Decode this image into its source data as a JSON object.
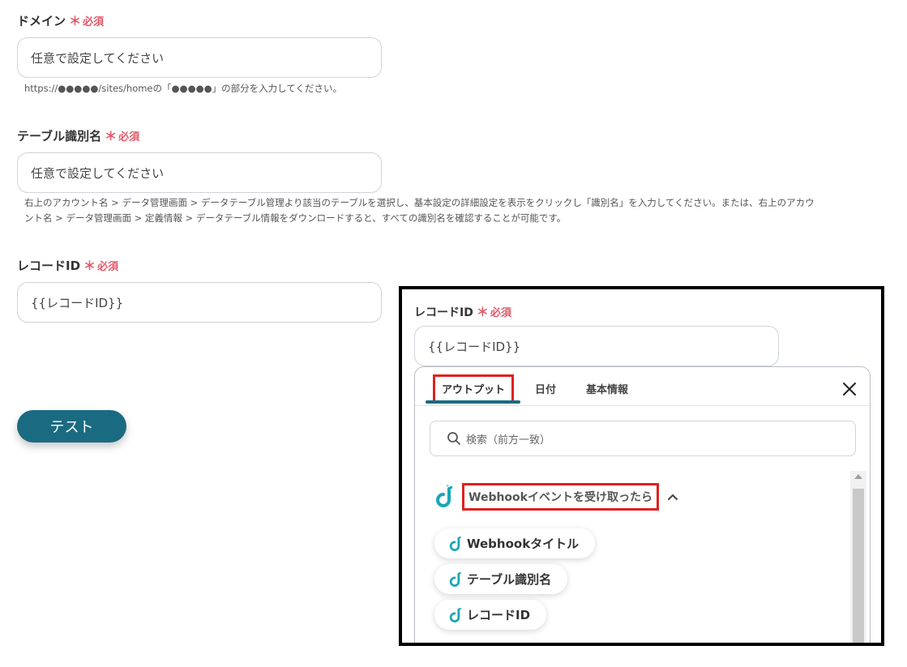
{
  "required_mark": "＊",
  "required_text": "必須",
  "domain": {
    "label": "ドメイン",
    "placeholder": "任意で設定してください",
    "note": "https://●●●●●/sites/homeの「●●●●●」の部分を入力してください。"
  },
  "table_id": {
    "label": "テーブル識別名",
    "placeholder": "任意で設定してください",
    "note_line1": "右上のアカウント名 > データ管理画面 > データテーブル管理より該当のテーブルを選択し、基本設定の詳細設定を表示をクリックし「識別名」を入力してください。または、右上のアカウ",
    "note_line2": "ント名 > データ管理画面 > 定義情報 > データテーブル情報をダウンロードすると、すべての識別名を確認することが可能です。"
  },
  "record_id": {
    "label": "レコードID",
    "value": "{{レコードID}}"
  },
  "test_button": "テスト",
  "picker": {
    "tabs": [
      "アウトプット",
      "日付",
      "基本情報"
    ],
    "search_placeholder": "検索（前方一致）",
    "group_title": "Webhookイベントを受け取ったら",
    "items": [
      "Webhookタイトル",
      "テーブル識別名",
      "レコードID"
    ]
  },
  "colors": {
    "accent": "#1a6b82",
    "required": "#e05a6a",
    "highlight": "#e02020",
    "brand_teal": "#1aa6b7"
  },
  "icons": [
    "yoom-logo-icon",
    "search-icon",
    "close-icon",
    "chevron-up-icon"
  ]
}
